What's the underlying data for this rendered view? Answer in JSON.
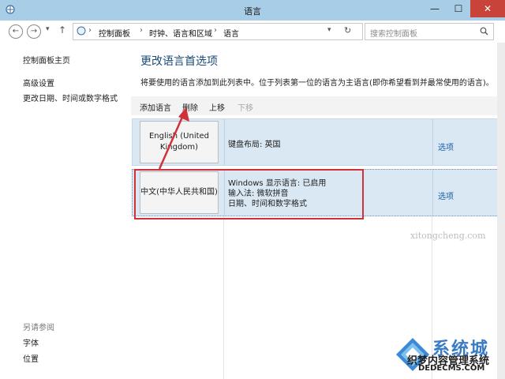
{
  "window": {
    "title": "语言",
    "minimize": "—",
    "maximize": "☐",
    "close": "✕"
  },
  "address": {
    "crumbs": [
      "控制面板",
      "时钟、语言和区域",
      "语言"
    ],
    "search_placeholder": "搜索控制面板"
  },
  "sidebar": {
    "items": [
      "控制面板主页",
      "高级设置",
      "更改日期、时间或数字格式"
    ],
    "see_also_label": "另请参阅",
    "see_also_items": [
      "字体",
      "位置"
    ]
  },
  "main": {
    "title": "更改语言首选项",
    "description": "将要使用的语言添加到此列表中。位于列表第一位的语言为主语言(即你希望看到并最常使用的语言)。",
    "toolbar": [
      "添加语言",
      "删除",
      "上移",
      "下移"
    ],
    "languages": [
      {
        "name": "English (United Kingdom)",
        "details": [
          "键盘布局: 英国"
        ],
        "options_label": "选项"
      },
      {
        "name": "中文(中华人民共和国)",
        "details": [
          "Windows 显示语言: 已启用",
          "输入法: 微软拼音",
          "日期、时间和数字格式"
        ],
        "options_label": "选项"
      }
    ]
  },
  "watermark": {
    "brand": "系统城",
    "line2": "织梦内容管理系统",
    "line3": "DEDECMS.COM",
    "faint": "xitongcheng.com"
  },
  "colors": {
    "titlebar": "#a8cde6",
    "selection": "#d9e8f3",
    "highlight_box": "#d1323a",
    "arrow": "#d1323a",
    "link": "#1a5fa8"
  }
}
